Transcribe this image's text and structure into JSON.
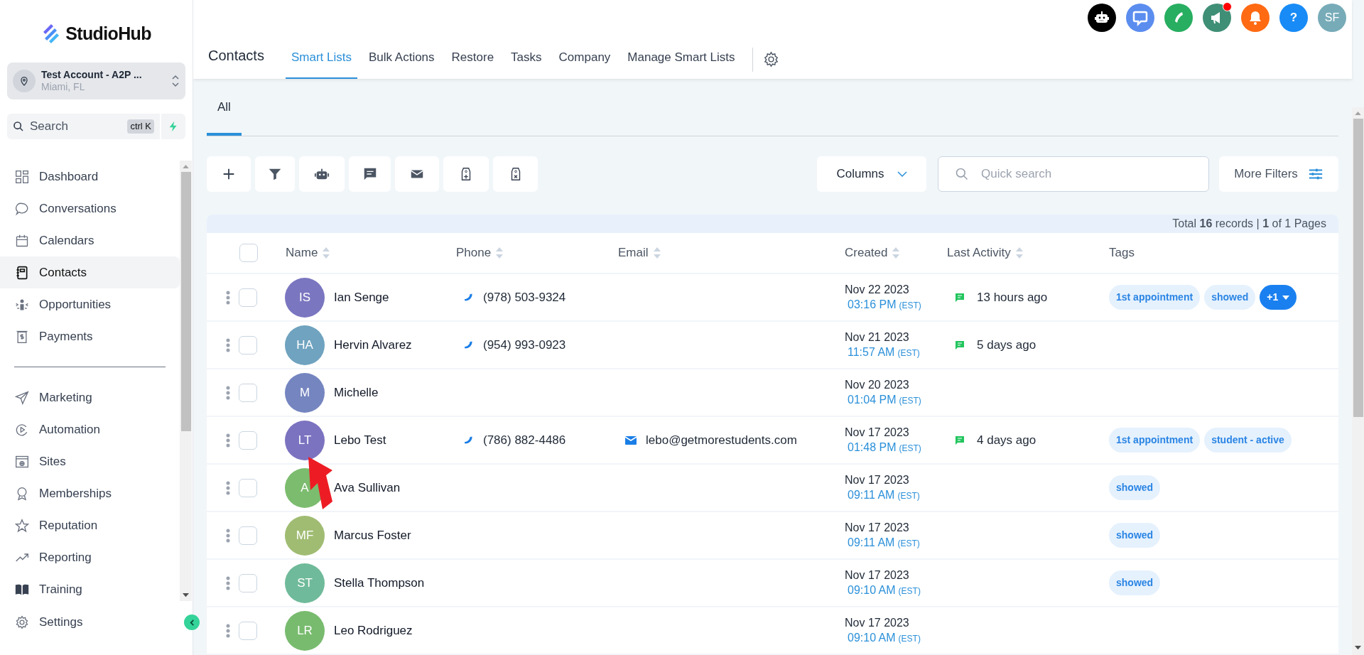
{
  "sidebar": {
    "logo": "StudioHub",
    "account": {
      "name": "Test Account - A2P ...",
      "location": "Miami, FL"
    },
    "search": {
      "placeholder": "Search",
      "shortcut": "ctrl K"
    },
    "nav_items": [
      {
        "label": "Dashboard",
        "selected": false
      },
      {
        "label": "Conversations",
        "selected": false
      },
      {
        "label": "Calendars",
        "selected": false
      },
      {
        "label": "Contacts",
        "selected": true
      },
      {
        "label": "Opportunities",
        "selected": false
      },
      {
        "label": "Payments",
        "selected": false
      }
    ],
    "nav_items_2": [
      {
        "label": "Marketing",
        "selected": false
      },
      {
        "label": "Automation",
        "selected": false
      },
      {
        "label": "Sites",
        "selected": false
      },
      {
        "label": "Memberships",
        "selected": false
      },
      {
        "label": "Reputation",
        "selected": false
      },
      {
        "label": "Reporting",
        "selected": false
      },
      {
        "label": "Training",
        "selected": false
      }
    ],
    "settings": "Settings"
  },
  "top_bar": {
    "announcements_unread": true,
    "help": "?",
    "user_initials": "SF"
  },
  "header": {
    "title": "Contacts",
    "tabs": [
      {
        "label": "Smart Lists",
        "selected": true
      },
      {
        "label": "Bulk Actions",
        "selected": false
      },
      {
        "label": "Restore",
        "selected": false
      },
      {
        "label": "Tasks",
        "selected": false
      },
      {
        "label": "Company",
        "selected": false
      },
      {
        "label": "Manage Smart Lists",
        "selected": false
      }
    ]
  },
  "list_tabs": [
    {
      "label": "All",
      "selected": true
    }
  ],
  "toolbar": {
    "columns": "Columns",
    "search_placeholder": "Quick search",
    "more_filters": "More Filters"
  },
  "select_all_checked": false,
  "records": "Total **16** records | **1** of 1 Pages",
  "table": {
    "columns": [
      {
        "label": "Name",
        "sortable": true
      },
      {
        "label": "Phone",
        "sortable": true
      },
      {
        "label": "Email",
        "sortable": true
      },
      {
        "label": "Created",
        "sortable": true
      },
      {
        "label": "Last Activity",
        "sortable": true
      },
      {
        "label": "Tags",
        "sortable": false
      }
    ],
    "rows": [
      {
        "initials": "IS",
        "color": "#7b76c0",
        "name": "Ian Senge",
        "checked": false,
        "phone": "(978) 503-9324",
        "created_date": "Nov 22 2023",
        "created_time": "03:16 PM",
        "timezone": "(EST)",
        "last_activity": "13 hours ago",
        "tags": [
          "1st appointment",
          "showed"
        ],
        "more_tags": "+1"
      },
      {
        "initials": "HA",
        "color": "#6fa3bf",
        "name": "Hervin Alvarez",
        "checked": false,
        "phone": "(954) 993-0923",
        "created_date": "Nov 21 2023",
        "created_time": "11:57 AM",
        "timezone": "(EST)",
        "last_activity": "5 days ago"
      },
      {
        "initials": "M",
        "color": "#7585c0",
        "name": "Michelle",
        "checked": false,
        "created_date": "Nov 20 2023",
        "created_time": "01:04 PM",
        "timezone": "(EST)"
      },
      {
        "initials": "LT",
        "color": "#7b73c0",
        "name": "Lebo Test",
        "checked": false,
        "phone": "(786) 882-4486",
        "email": "lebo@getmorestudents.com",
        "created_date": "Nov 17 2023",
        "created_time": "01:48 PM",
        "timezone": "(EST)",
        "last_activity": "4 days ago",
        "tags": [
          "1st appointment",
          "student - active"
        ]
      },
      {
        "initials": "A",
        "color": "#7cbc6e",
        "name": "Ava Sullivan",
        "checked": false,
        "created_date": "Nov 17 2023",
        "created_time": "09:11 AM",
        "timezone": "(EST)",
        "tags": [
          "showed"
        ]
      },
      {
        "initials": "MF",
        "color": "#a0bc72",
        "name": "Marcus Foster",
        "checked": false,
        "created_date": "Nov 17 2023",
        "created_time": "09:11 AM",
        "timezone": "(EST)",
        "tags": [
          "showed"
        ]
      },
      {
        "initials": "ST",
        "color": "#6fba9a",
        "name": "Stella Thompson",
        "checked": false,
        "created_date": "Nov 17 2023",
        "created_time": "09:10 AM",
        "timezone": "(EST)",
        "tags": [
          "showed"
        ]
      },
      {
        "initials": "LR",
        "color": "#78bb6e",
        "name": "Leo Rodriguez",
        "checked": false,
        "created_date": "Nov 17 2023",
        "created_time": "09:10 AM",
        "timezone": "(EST)"
      }
    ]
  }
}
